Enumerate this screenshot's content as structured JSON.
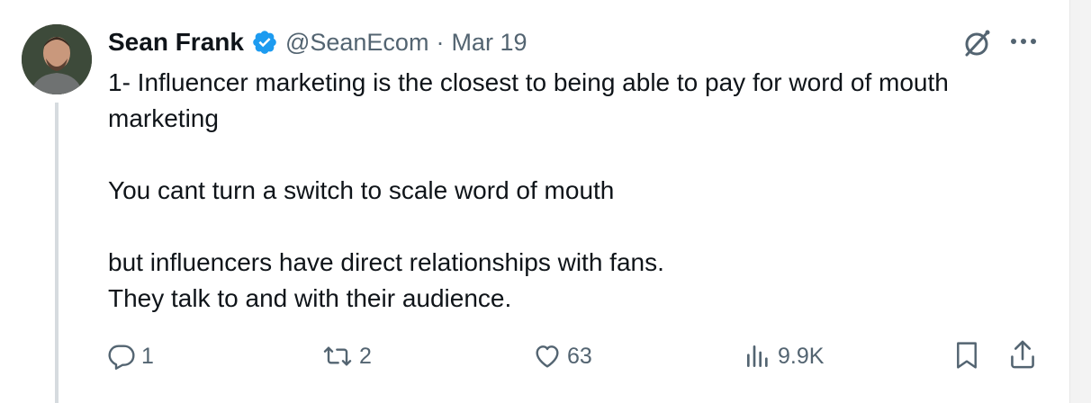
{
  "tweet": {
    "author_name": "Sean Frank",
    "handle": "@SeanEcom",
    "separator": "·",
    "date": "Mar 19",
    "text": "1- Influencer marketing is the closest to being able to pay for word of mouth\nmarketing\n\nYou cant turn a switch to scale word of mouth\n\nbut influencers have direct relationships with fans.\nThey talk to and with their audience."
  },
  "actions": {
    "replies": "1",
    "retweets": "2",
    "likes": "63",
    "views": "9.9K"
  },
  "colors": {
    "verified": "#1d9bf0",
    "muted": "#536471",
    "text": "#0f1419",
    "thread_line": "#d6dbdf"
  },
  "icons": [
    "verified-badge-icon",
    "grok-icon",
    "more-icon",
    "reply-icon",
    "retweet-icon",
    "like-icon",
    "views-icon",
    "bookmark-icon",
    "share-icon"
  ]
}
